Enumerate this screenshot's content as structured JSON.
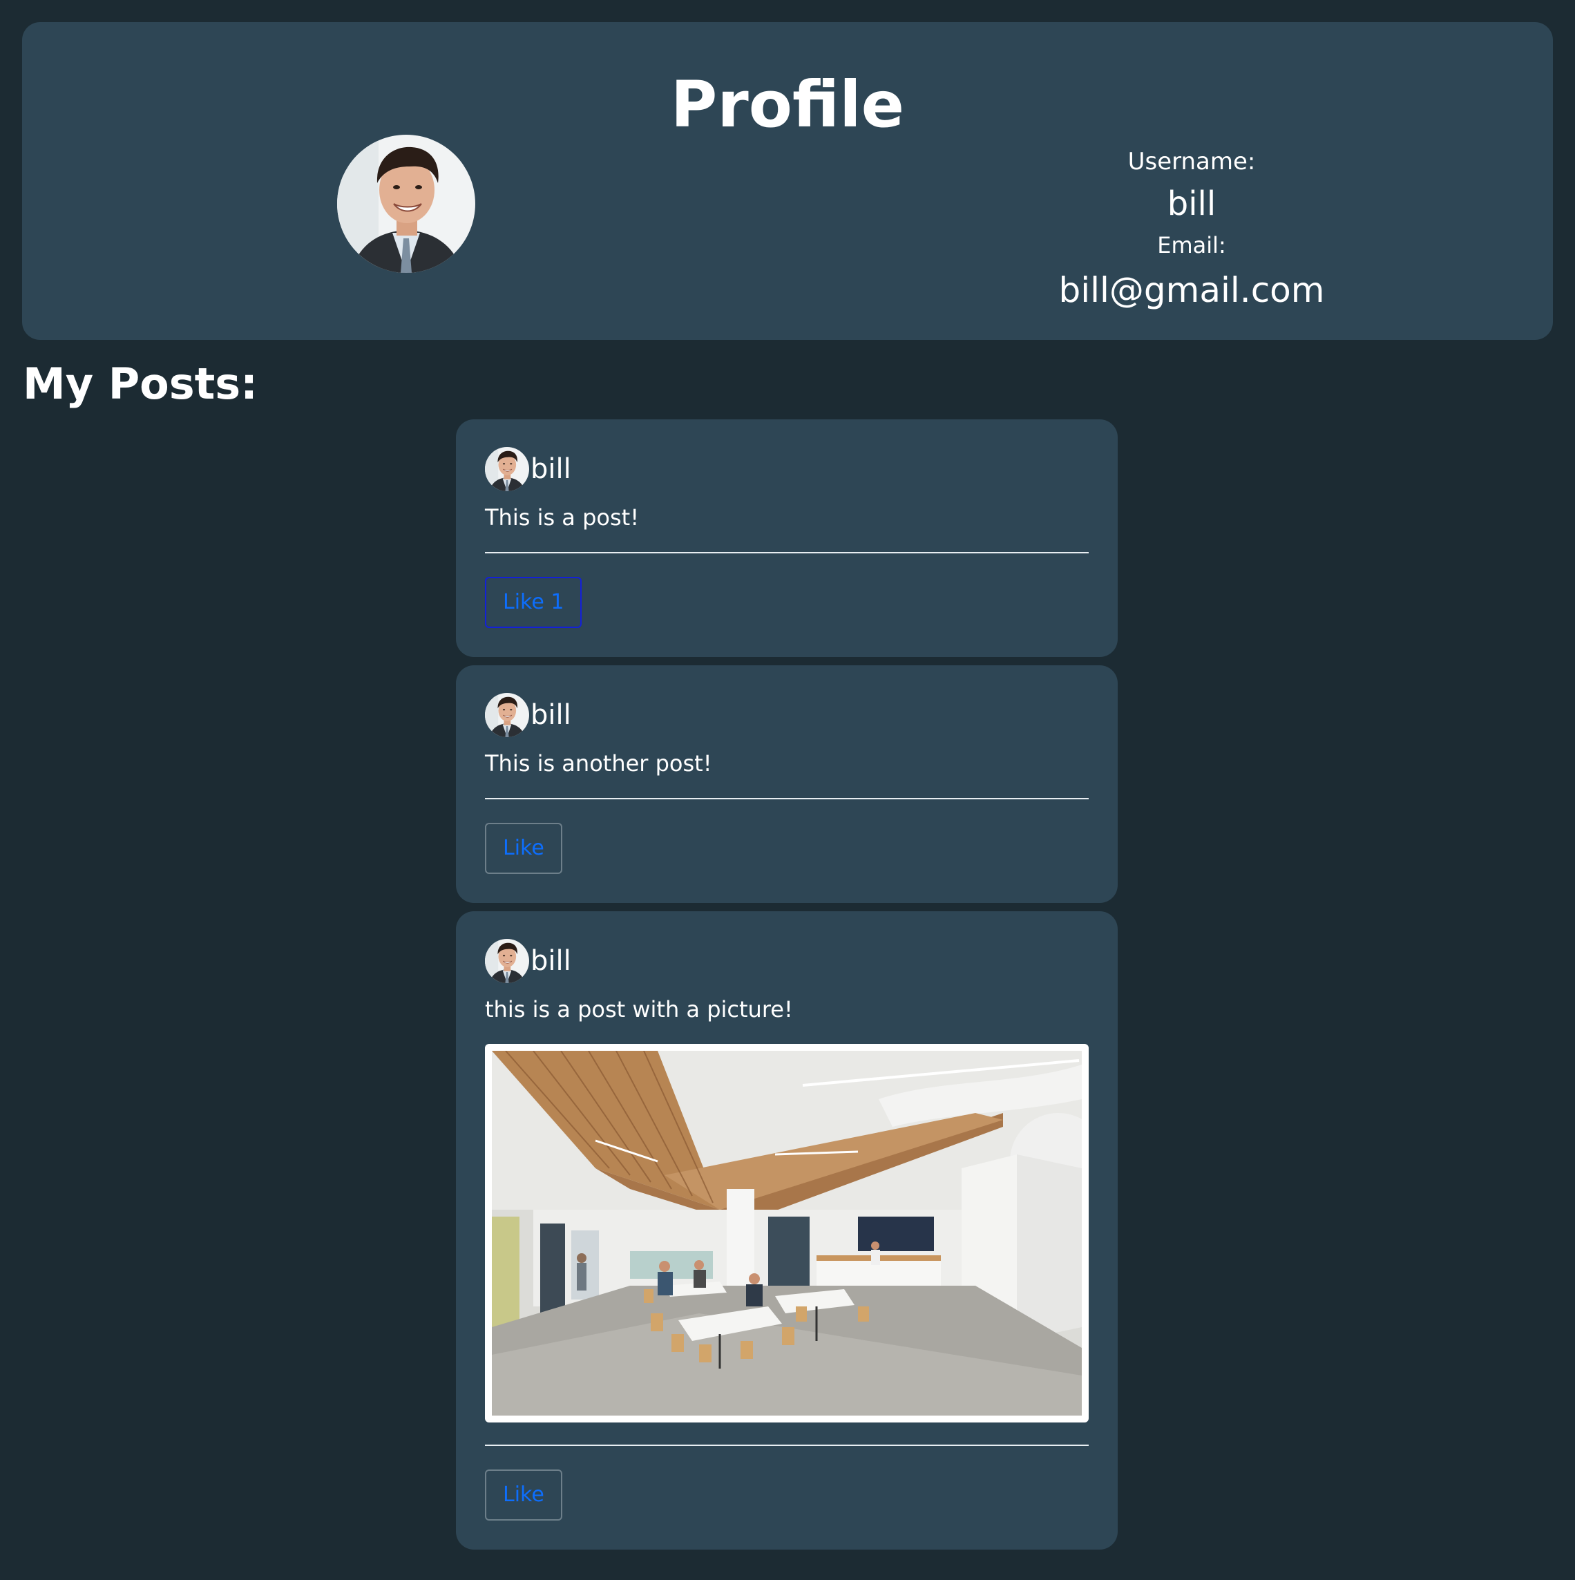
{
  "profile": {
    "title": "Profile",
    "username_label": "Username:",
    "username": "bill",
    "email_label": "Email:",
    "email": "bill@gmail.com",
    "avatar_icon": "user-avatar-photo"
  },
  "posts_section": {
    "heading": "My Posts:"
  },
  "posts": [
    {
      "author": "bill",
      "text": "This is a post!",
      "like_label": "Like 1",
      "like_count": 1,
      "has_image": false
    },
    {
      "author": "bill",
      "text": "This is another post!",
      "like_label": "Like",
      "like_count": 0,
      "has_image": false
    },
    {
      "author": "bill",
      "text": "this is a post with a picture!",
      "like_label": "Like",
      "like_count": 0,
      "has_image": true,
      "image_icon": "office-cafeteria-photo"
    }
  ],
  "colors": {
    "page_background": "#1c2b33",
    "card_background": "#2e4655",
    "like_text": "#0d6efd",
    "active_like_border": "#1320d8"
  }
}
